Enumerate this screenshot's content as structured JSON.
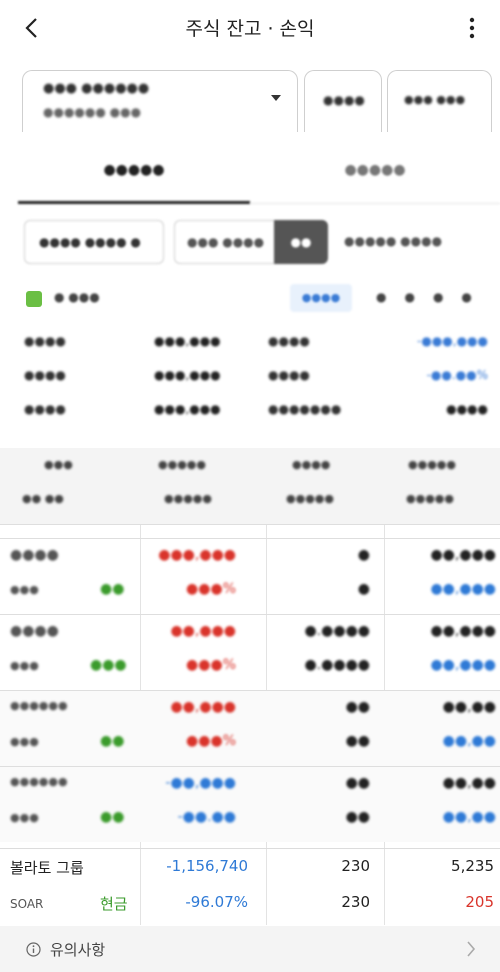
{
  "header": {
    "title": "주식 잔고 · 손익"
  },
  "account": {
    "name": "●●● ●●●●●●",
    "sub": "●●●●●● ●●●",
    "box2": "●●●●",
    "box3": "●●● ●●●"
  },
  "tabs": [
    {
      "label": "●●●●●"
    },
    {
      "label": "●●●●●"
    }
  ],
  "filters": {
    "a": "●●●● ●●●● ●",
    "b": "●●● ●●●●",
    "c": "●●",
    "d": "●●●●● ●●●●"
  },
  "options": {
    "label": "● ●●●",
    "button": "●●●●",
    "rest": "●●●●"
  },
  "summary": [
    {
      "l1": "●●●●",
      "v1": "●●●,●●●",
      "l2": "●●●●",
      "v2": "-●●●,●●●",
      "dark": false
    },
    {
      "l1": "●●●●",
      "v1": "●●●,●●●",
      "l2": "●●●●",
      "v2": "-●●.●●%",
      "dark": false
    },
    {
      "l1": "●●●●",
      "v1": "●●●,●●●",
      "l2": "●●●●●●●",
      "v2": "●●●●",
      "dark": true
    }
  ],
  "grid_header": {
    "c1a": "●●●",
    "c2a": "●●●●●",
    "c3a": "●●●●",
    "c4a": "●●●●●",
    "c1b": "●●  ●●",
    "c2b": "●●●●●",
    "c3b": "●●●●●",
    "c4b": "●●●●●"
  },
  "rows": [
    {
      "name": "●●●●",
      "code": "●●●",
      "tag": "●●",
      "pl": "●●●,●●●",
      "rate": "●●●%",
      "qty1": "●",
      "qty2": "●",
      "v1": "●●,●●●",
      "v2": "●●,●●●"
    },
    {
      "name": "●●●●",
      "code": "●●●",
      "tag": "●●●",
      "pl": "●●,●●●",
      "rate": "●●●%",
      "qty1": "●.●●●●",
      "qty2": "●.●●●●",
      "v1": "●●,●●●",
      "v2": "●●,●●●"
    },
    {
      "name": "●●●●●●",
      "code": "●●●",
      "tag": "●●",
      "pl": "●●,●●●",
      "rate": "●●●%",
      "qty1": "●●",
      "qty2": "●●",
      "v1": "●●,●●",
      "v2": "●●,●●"
    },
    {
      "name": "●●●●●●",
      "code": "●●●",
      "tag": "●●",
      "pl": "-●●,●●●",
      "rate": "-●●.●●",
      "qty1": "●●",
      "qty2": "●●",
      "v1": "●●,●●",
      "v2": "●●,●●"
    }
  ],
  "last_row": {
    "name": "볼라토 그룹",
    "code": "SOAR",
    "tag": "현금",
    "pl": "-1,156,740",
    "rate": "-96.07%",
    "qty1": "230",
    "qty2": "230",
    "v1": "5,235",
    "v2": "205"
  },
  "notice": {
    "label": "유의사항"
  }
}
